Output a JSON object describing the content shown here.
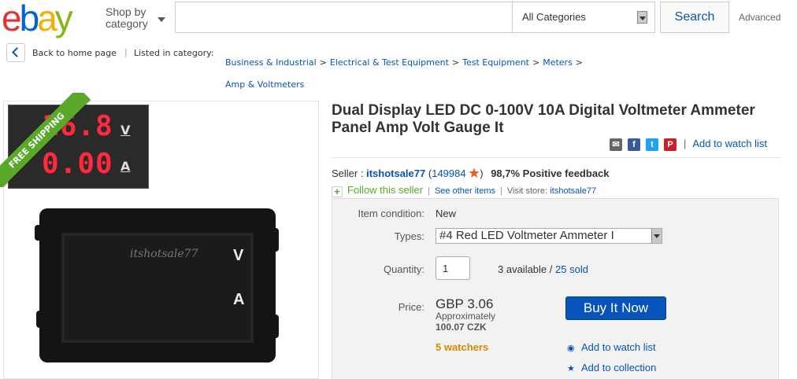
{
  "header": {
    "logo_letters": [
      "e",
      "b",
      "a",
      "y"
    ],
    "shop_by_line1": "Shop by",
    "shop_by_line2": "category",
    "search_placeholder": "",
    "category_select": "All Categories",
    "search_button": "Search",
    "advanced_link": "Advanced"
  },
  "breadcrumb": {
    "back_label": "Back to home page",
    "separator": "|",
    "listed_label": "Listed in category:",
    "items": [
      "Business & Industrial",
      "Electrical & Test Equipment",
      "Test Equipment",
      "Meters",
      "Amp & Voltmeters"
    ],
    "arrow": ">"
  },
  "image": {
    "ribbon_text": "FREE SHIPPING",
    "thumb_volts": "16.8",
    "thumb_amps": "0.00",
    "unit_v": "V",
    "unit_a": "A",
    "watermark": "itshotsale77"
  },
  "item": {
    "title": "Dual Display LED DC 0-100V 10A Digital Voltmeter Ammeter Panel Amp Volt Gauge It",
    "share_icons": [
      "email-icon",
      "facebook-icon",
      "twitter-icon",
      "pinterest-icon"
    ],
    "add_watch_top": "Add to watch list",
    "bar": "|"
  },
  "seller": {
    "label": "Seller :",
    "name": "itshotsale77",
    "feedback_open": "(",
    "feedback_count": "149984",
    "feedback_close": ")",
    "positive": "98,7% Positive feedback",
    "follow": "Follow this seller",
    "see_other": "See other items",
    "visit_label": "Visit store:",
    "store": "itshotsale77"
  },
  "purchase": {
    "condition_label": "Item condition:",
    "condition_value": "New",
    "types_label": "Types:",
    "types_value": "#4 Red LED Voltmeter Ammeter I",
    "quantity_label": "Quantity:",
    "quantity_value": "1",
    "available": "3 available",
    "slash": "/",
    "sold": "25 sold",
    "price_label": "Price:",
    "price": "GBP 3.06",
    "approx_label": "Approximately",
    "approx_value": "100.07 CZK",
    "watchers": "5 watchers",
    "buy_now": "Buy It Now",
    "add_watch": "Add to watch list",
    "add_collection": "Add to collection"
  },
  "colors": {
    "ebay_red": "#e53238",
    "ebay_blue": "#0654ba",
    "ebay_yellow": "#f5af02",
    "ebay_green": "#86b817",
    "ribbon_green": "#5aa82a",
    "watchers_orange": "#dd8800",
    "led_red": "#ff2a3b"
  }
}
